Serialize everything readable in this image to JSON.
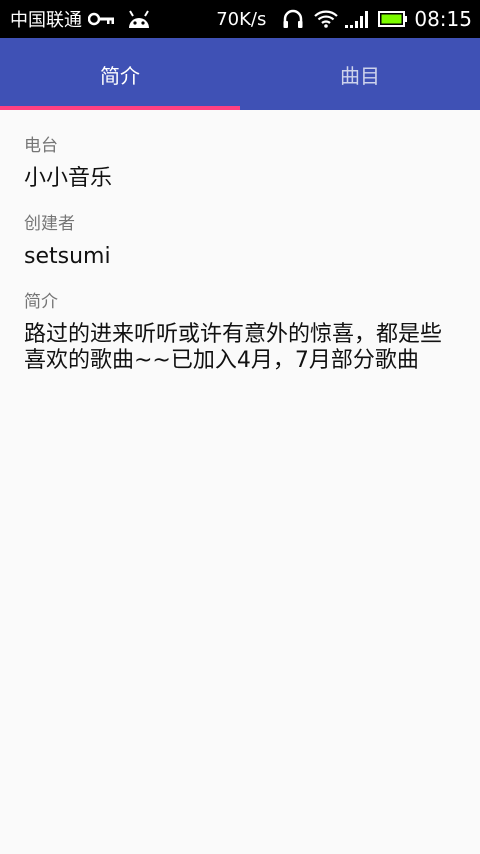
{
  "status_bar": {
    "carrier": "中国联通",
    "net_speed": "70K/s",
    "time": "08:15",
    "icons": [
      "key-icon",
      "android-icon",
      "headset-icon",
      "wifi-icon",
      "signal-icon",
      "battery-icon"
    ],
    "battery_color": "#7cfc00"
  },
  "tabs": [
    {
      "label": "简介",
      "active": true
    },
    {
      "label": "曲目",
      "active": false
    }
  ],
  "colors": {
    "primary": "#3f51b5",
    "indicator": "#ff4081"
  },
  "station": {
    "label": "电台",
    "value": "小小音乐"
  },
  "creator": {
    "label": "创建者",
    "value": "setsumi"
  },
  "intro": {
    "label": "简介",
    "value": "路过的进来听听或许有意外的惊喜，都是些喜欢的歌曲~~已加入4月，7月部分歌曲"
  }
}
